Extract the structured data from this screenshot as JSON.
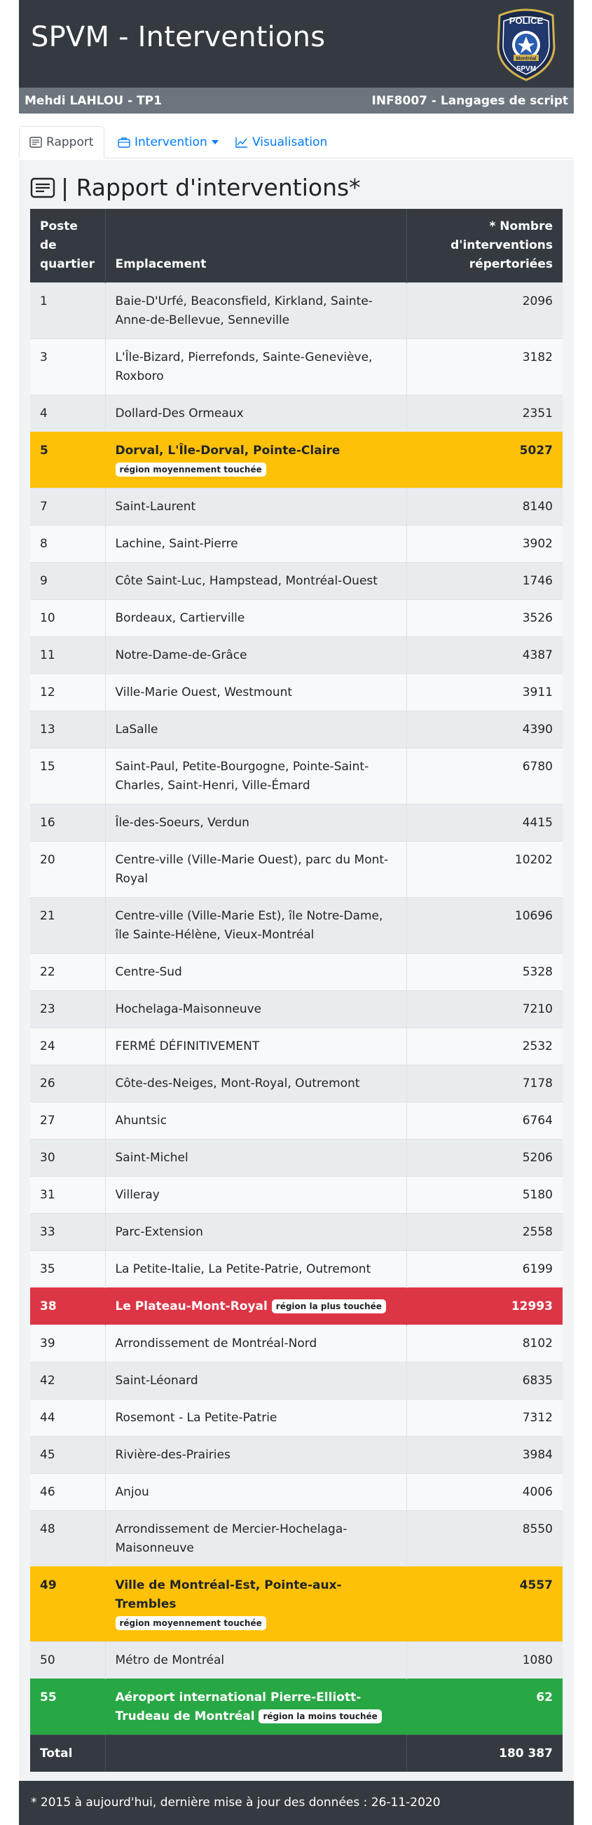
{
  "header": {
    "title": "SPVM - Interventions",
    "logo_top_text": "POLICE",
    "logo_band_text": "Montréal",
    "logo_bottom_text": "SPVM"
  },
  "subbar": {
    "author": "Mehdi LAHLOU - TP1",
    "course": "INF8007 - Langages de script"
  },
  "tabs": [
    {
      "label": "Rapport",
      "icon": "document-icon",
      "active": true
    },
    {
      "label": "Intervention",
      "icon": "briefcase-icon",
      "dropdown": true
    },
    {
      "label": "Visualisation",
      "icon": "chart-line-icon"
    }
  ],
  "page_title": "| Rapport d'interventions*",
  "table": {
    "headers": [
      "Poste de quartier",
      "Emplacement",
      "* Nombre d'interventions répertoriées"
    ],
    "rows": [
      {
        "poste": "1",
        "emplacement": "Baie-D'Urfé, Beaconsfield, Kirkland, Sainte-Anne-de-Bellevue, Senneville",
        "nombre": "2096"
      },
      {
        "poste": "3",
        "emplacement": "L'Île-Bizard, Pierrefonds, Sainte-Geneviève, Roxboro",
        "nombre": "3182"
      },
      {
        "poste": "4",
        "emplacement": "Dollard-Des Ormeaux",
        "nombre": "2351"
      },
      {
        "poste": "5",
        "emplacement": "Dorval, L'Île-Dorval, Pointe-Claire",
        "nombre": "5027",
        "badge": "région moyennement touchée",
        "status": "warn",
        "badge_newline": true
      },
      {
        "poste": "7",
        "emplacement": "Saint-Laurent",
        "nombre": "8140"
      },
      {
        "poste": "8",
        "emplacement": "Lachine, Saint-Pierre",
        "nombre": "3902"
      },
      {
        "poste": "9",
        "emplacement": "Côte Saint-Luc, Hampstead, Montréal-Ouest",
        "nombre": "1746"
      },
      {
        "poste": "10",
        "emplacement": "Bordeaux, Cartierville",
        "nombre": "3526"
      },
      {
        "poste": "11",
        "emplacement": "Notre-Dame-de-Grâce",
        "nombre": "4387"
      },
      {
        "poste": "12",
        "emplacement": "Ville-Marie Ouest, Westmount",
        "nombre": "3911"
      },
      {
        "poste": "13",
        "emplacement": "LaSalle",
        "nombre": "4390"
      },
      {
        "poste": "15",
        "emplacement": "Saint-Paul, Petite-Bourgogne, Pointe-Saint-Charles, Saint-Henri, Ville-Émard",
        "nombre": "6780"
      },
      {
        "poste": "16",
        "emplacement": "Île-des-Soeurs, Verdun",
        "nombre": "4415"
      },
      {
        "poste": "20",
        "emplacement": "Centre-ville (Ville-Marie Ouest), parc du Mont-Royal",
        "nombre": "10202"
      },
      {
        "poste": "21",
        "emplacement": "Centre-ville (Ville-Marie Est), île Notre-Dame, île Sainte-Hélène, Vieux-Montréal",
        "nombre": "10696"
      },
      {
        "poste": "22",
        "emplacement": "Centre-Sud",
        "nombre": "5328"
      },
      {
        "poste": "23",
        "emplacement": "Hochelaga-Maisonneuve",
        "nombre": "7210"
      },
      {
        "poste": "24",
        "emplacement": "FERMÉ DÉFINITIVEMENT",
        "nombre": "2532"
      },
      {
        "poste": "26",
        "emplacement": "Côte-des-Neiges, Mont-Royal, Outremont",
        "nombre": "7178"
      },
      {
        "poste": "27",
        "emplacement": "Ahuntsic",
        "nombre": "6764"
      },
      {
        "poste": "30",
        "emplacement": "Saint-Michel",
        "nombre": "5206"
      },
      {
        "poste": "31",
        "emplacement": "Villeray",
        "nombre": "5180"
      },
      {
        "poste": "33",
        "emplacement": "Parc-Extension",
        "nombre": "2558"
      },
      {
        "poste": "35",
        "emplacement": "La Petite-Italie, La Petite-Patrie, Outremont",
        "nombre": "6199"
      },
      {
        "poste": "38",
        "emplacement": "Le Plateau-Mont-Royal",
        "nombre": "12993",
        "badge": "région la plus touchée",
        "status": "danger"
      },
      {
        "poste": "39",
        "emplacement": "Arrondissement de Montréal-Nord",
        "nombre": "8102"
      },
      {
        "poste": "42",
        "emplacement": "Saint-Léonard",
        "nombre": "6835"
      },
      {
        "poste": "44",
        "emplacement": "Rosemont - La Petite-Patrie",
        "nombre": "7312"
      },
      {
        "poste": "45",
        "emplacement": "Rivière-des-Prairies",
        "nombre": "3984"
      },
      {
        "poste": "46",
        "emplacement": "Anjou",
        "nombre": "4006"
      },
      {
        "poste": "48",
        "emplacement": "Arrondissement de Mercier-Hochelaga-Maisonneuve",
        "nombre": "8550"
      },
      {
        "poste": "49",
        "emplacement": "Ville de Montréal-Est, Pointe-aux-Trembles",
        "nombre": "4557",
        "badge": "région moyennement touchée",
        "status": "warn",
        "badge_newline": true
      },
      {
        "poste": "50",
        "emplacement": "Métro de Montréal",
        "nombre": "1080"
      },
      {
        "poste": "55",
        "emplacement": "Aéroport international Pierre-Elliott-Trudeau de Montréal",
        "nombre": "62",
        "badge": "région la moins touchée",
        "status": "success"
      }
    ],
    "total_label": "Total",
    "total_value": "180 387"
  },
  "footer": "* 2015 à aujourd'hui, dernière mise à jour des données : 26-11-2020",
  "colors": {
    "dark": "#343a40",
    "gray": "#6c757d",
    "link": "#007bff",
    "warning": "#ffc107",
    "danger": "#dc3545",
    "success": "#28a745"
  }
}
